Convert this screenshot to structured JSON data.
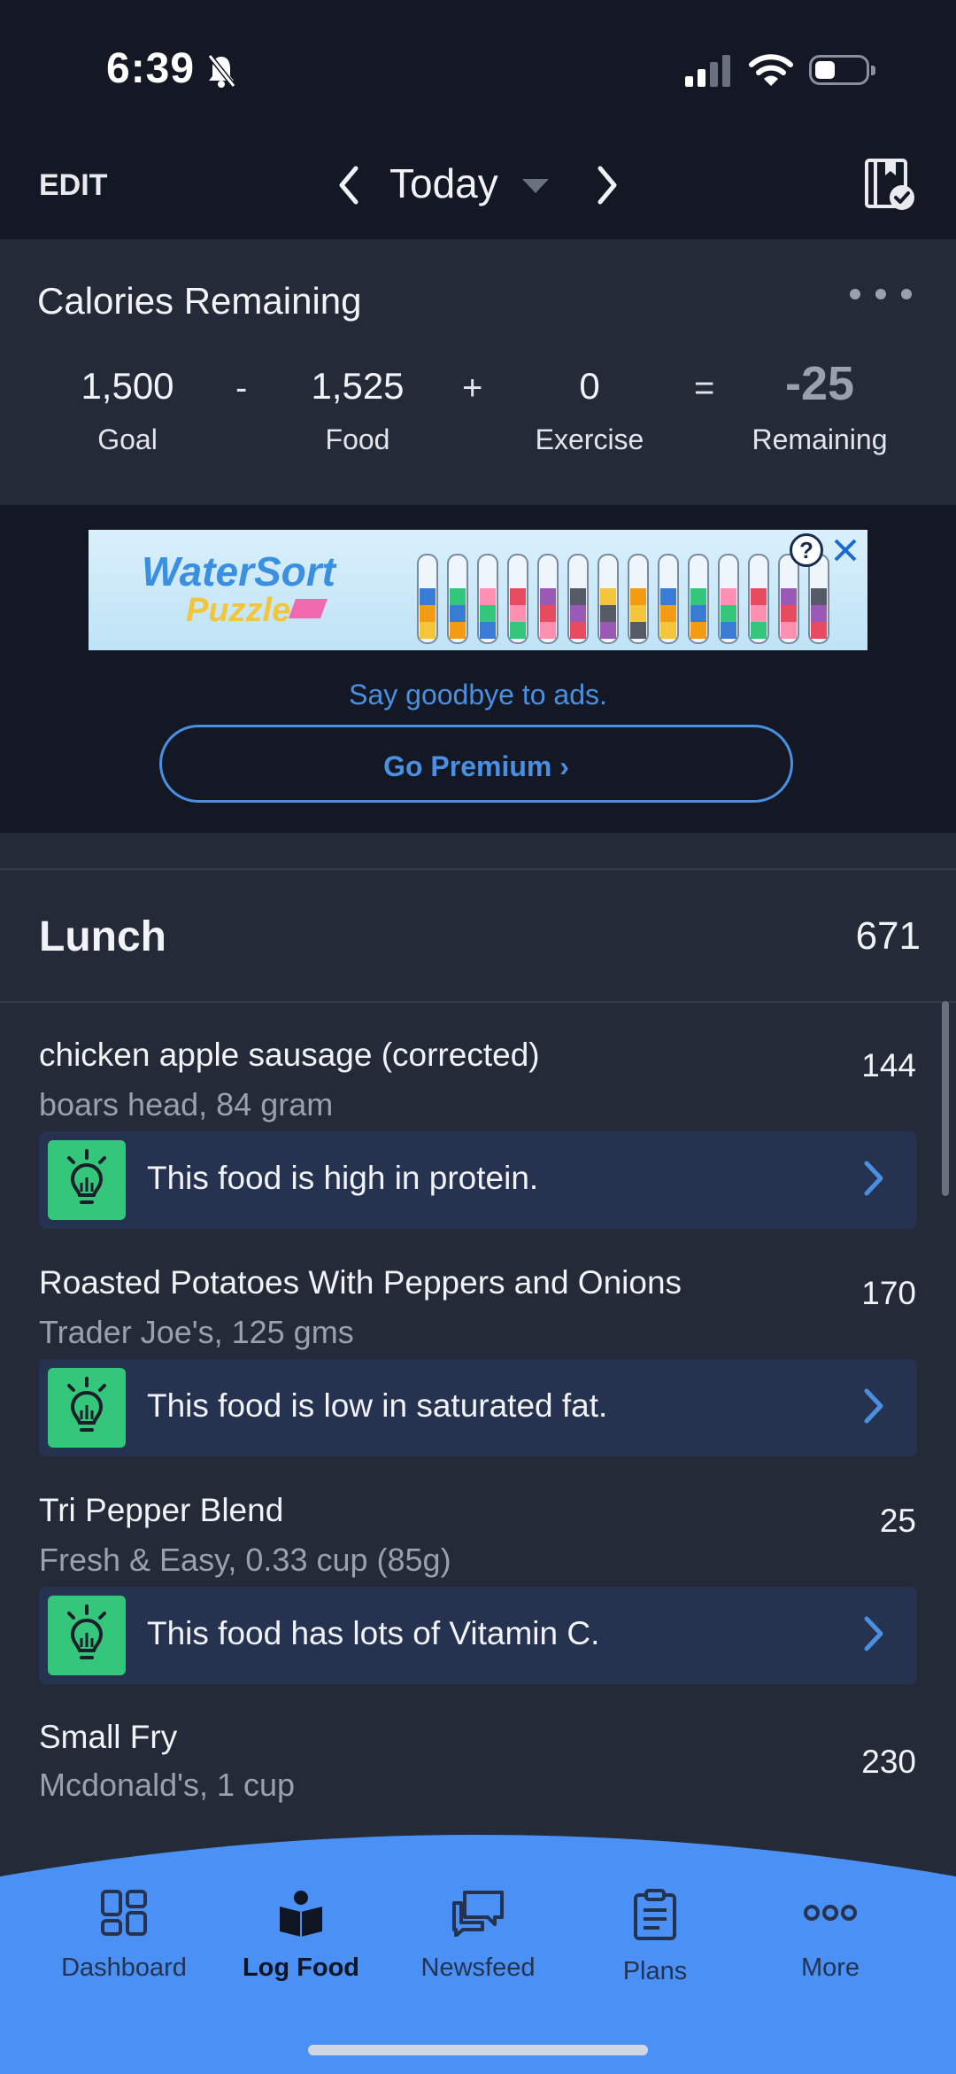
{
  "status_bar": {
    "time": "6:39",
    "icons": [
      "bell-slash-icon",
      "cellular-signal-icon",
      "wifi-icon",
      "battery-icon"
    ]
  },
  "nav": {
    "edit": "EDIT",
    "date": "Today",
    "icons": [
      "chevron-left-icon",
      "caret-down-icon",
      "chevron-right-icon",
      "diary-complete-icon"
    ]
  },
  "calories": {
    "title": "Calories Remaining",
    "goal_value": "1,500",
    "goal_label": "Goal",
    "op_minus": "-",
    "food_value": "1,525",
    "food_label": "Food",
    "op_plus": "+",
    "exercise_value": "0",
    "exercise_label": "Exercise",
    "op_equals": "=",
    "remaining_value": "-25",
    "remaining_label": "Remaining",
    "remaining_color": "#9aa0ad"
  },
  "ad": {
    "brand": "WaterSort",
    "brand_sub": "Puzzle",
    "info_icon": "question-circle-icon",
    "close_icon": "close-icon",
    "say_goodbye": "Say goodbye to ads.",
    "premium": "Go Premium ›"
  },
  "lunch": {
    "title": "Lunch",
    "total": "671",
    "items": [
      {
        "name": "chicken apple sausage (corrected)",
        "desc": "boars head, 84 gram",
        "calories": "144",
        "tip": "This food is high in protein."
      },
      {
        "name": "Roasted Potatoes With Peppers and Onions",
        "desc": "Trader Joe's, 125 gms",
        "calories": "170",
        "tip": "This food is low in saturated fat."
      },
      {
        "name": "Tri Pepper Blend",
        "desc": "Fresh & Easy, 0.33 cup (85g)",
        "calories": "25",
        "tip": "This food has lots of Vitamin C."
      },
      {
        "name": "Small Fry",
        "desc": "Mcdonald's, 1 cup",
        "calories": "230"
      }
    ]
  },
  "tabs": [
    {
      "label": "Dashboard",
      "icon": "dashboard-grid-icon"
    },
    {
      "label": "Log Food",
      "icon": "log-food-book-icon",
      "active": true
    },
    {
      "label": "Newsfeed",
      "icon": "newsfeed-chat-icon"
    },
    {
      "label": "Plans",
      "icon": "plans-clipboard-icon"
    },
    {
      "label": "More",
      "icon": "more-dots-icon"
    }
  ],
  "colors": {
    "accent": "#4a90e2",
    "tab_bar": "#4a90f5",
    "tip_icon_bg": "#34c77b",
    "card_bg": "#252a38",
    "page_bg": "#141824"
  }
}
